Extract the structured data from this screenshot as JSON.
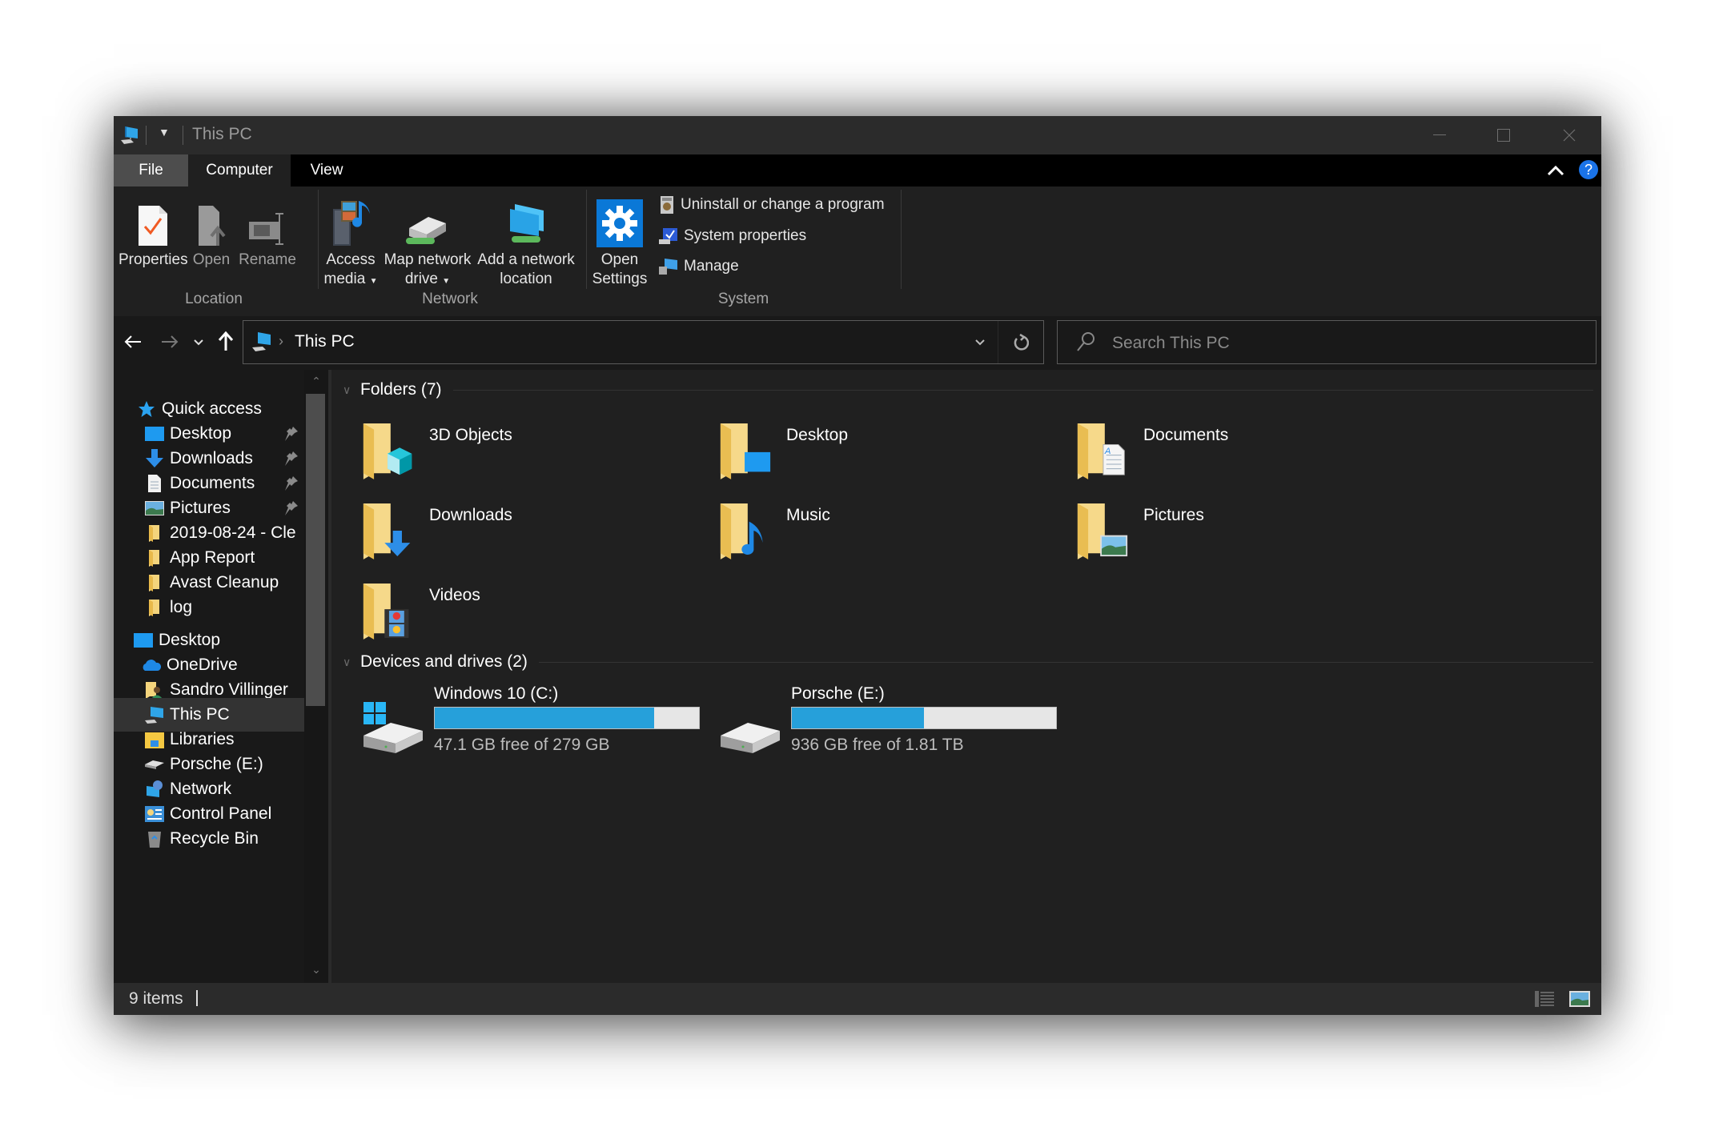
{
  "window": {
    "title": "This PC",
    "controls": [
      "minimize",
      "maximize",
      "close"
    ]
  },
  "ribbon_tabs": [
    {
      "label": "File",
      "active": false
    },
    {
      "label": "Computer",
      "active": true
    },
    {
      "label": "View",
      "active": false
    }
  ],
  "ribbon": {
    "location_group": {
      "label": "Location",
      "buttons": [
        {
          "label": "Properties",
          "icon": "properties-icon"
        },
        {
          "label": "Open",
          "icon": "open-icon"
        },
        {
          "label": "Rename",
          "icon": "rename-icon"
        }
      ]
    },
    "network_group": {
      "label": "Network",
      "buttons": [
        {
          "line1": "Access",
          "line2": "media",
          "has_dropdown": true,
          "icon": "access-media-icon"
        },
        {
          "line1": "Map network",
          "line2": "drive",
          "has_dropdown": true,
          "icon": "map-network-drive-icon"
        },
        {
          "line1": "Add a network",
          "line2": "location",
          "has_dropdown": false,
          "icon": "add-network-location-icon"
        }
      ]
    },
    "system_group": {
      "label": "System",
      "open_settings": {
        "line1": "Open",
        "line2": "Settings"
      },
      "items": [
        {
          "label": "Uninstall or change a program",
          "icon": "uninstall-icon"
        },
        {
          "label": "System properties",
          "icon": "system-properties-icon"
        },
        {
          "label": "Manage",
          "icon": "manage-icon"
        }
      ]
    },
    "collapse_icon": "chevron-up-icon",
    "help_label": "?"
  },
  "address": {
    "breadcrumb": [
      "This PC"
    ],
    "search_placeholder": "Search This PC"
  },
  "nav_pane": {
    "items": [
      {
        "label": "Quick access",
        "icon": "star-icon",
        "level": 0,
        "pinned": false
      },
      {
        "label": "Desktop",
        "icon": "desktop-icon",
        "level": 1,
        "pinned": true
      },
      {
        "label": "Downloads",
        "icon": "download-icon",
        "level": 1,
        "pinned": true
      },
      {
        "label": "Documents",
        "icon": "documents-icon",
        "level": 1,
        "pinned": true
      },
      {
        "label": "Pictures",
        "icon": "pictures-icon",
        "level": 1,
        "pinned": true
      },
      {
        "label": "2019-08-24 - Cle",
        "icon": "folder-icon",
        "level": 1,
        "pinned": false
      },
      {
        "label": "App Report",
        "icon": "folder-icon",
        "level": 1,
        "pinned": false
      },
      {
        "label": "Avast Cleanup",
        "icon": "folder-icon",
        "level": 1,
        "pinned": false
      },
      {
        "label": "log",
        "icon": "folder-icon",
        "level": 1,
        "pinned": false
      },
      {
        "label": "Desktop",
        "icon": "desktop-icon",
        "level": 0,
        "pinned": false
      },
      {
        "label": "OneDrive",
        "icon": "onedrive-icon",
        "level": 1,
        "pinned": false
      },
      {
        "label": "Sandro Villinger",
        "icon": "user-folder-icon",
        "level": 1,
        "pinned": false
      },
      {
        "label": "This PC",
        "icon": "this-pc-icon",
        "level": 1,
        "pinned": false,
        "selected": true
      },
      {
        "label": "Libraries",
        "icon": "libraries-icon",
        "level": 1,
        "pinned": false
      },
      {
        "label": "Porsche (E:)",
        "icon": "drive-icon",
        "level": 1,
        "pinned": false
      },
      {
        "label": "Network",
        "icon": "network-icon",
        "level": 1,
        "pinned": false
      },
      {
        "label": "Control Panel",
        "icon": "control-panel-icon",
        "level": 1,
        "pinned": false
      },
      {
        "label": "Recycle Bin",
        "icon": "recycle-bin-icon",
        "level": 1,
        "pinned": false
      }
    ]
  },
  "content": {
    "folders_section": {
      "label": "Folders (7)",
      "items": [
        {
          "name": "3D Objects",
          "overlay": "cube"
        },
        {
          "name": "Desktop",
          "overlay": "desktop"
        },
        {
          "name": "Documents",
          "overlay": "document"
        },
        {
          "name": "Downloads",
          "overlay": "download"
        },
        {
          "name": "Music",
          "overlay": "music"
        },
        {
          "name": "Pictures",
          "overlay": "picture"
        },
        {
          "name": "Videos",
          "overlay": "film"
        }
      ]
    },
    "drives_section": {
      "label": "Devices and drives (2)",
      "items": [
        {
          "name": "Windows 10 (C:)",
          "free_text": "47.1 GB free of 279 GB",
          "used_fraction": 0.83,
          "system": true
        },
        {
          "name": "Porsche (E:)",
          "free_text": "936 GB free of 1.81 TB",
          "used_fraction": 0.5,
          "system": false
        }
      ]
    }
  },
  "status_bar": {
    "item_count": "9 items",
    "views": [
      "details-view-icon",
      "large-icons-view-icon"
    ]
  },
  "colors": {
    "accent": "#26a0da",
    "folder": "#f4d47c",
    "help": "#1a73e8"
  }
}
